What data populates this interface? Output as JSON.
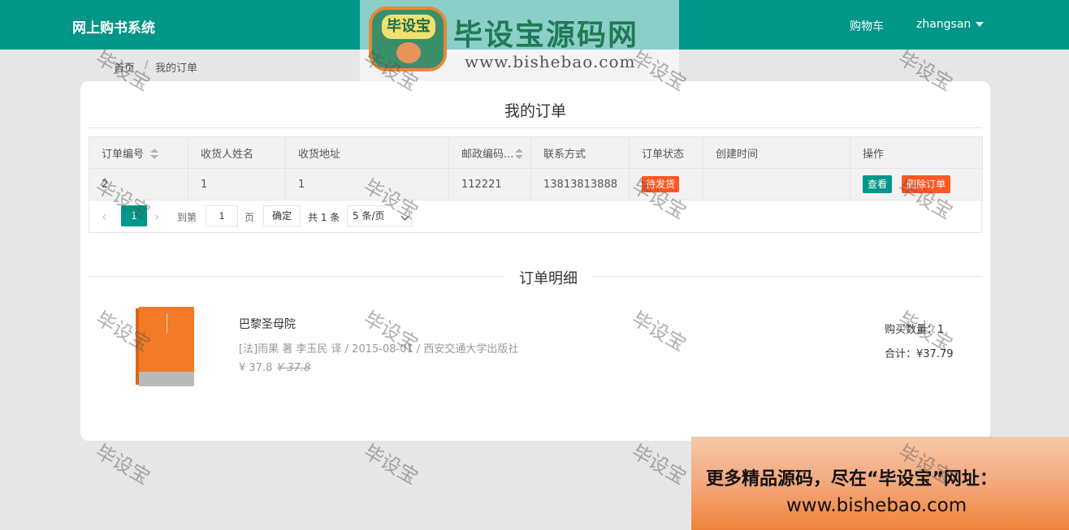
{
  "header": {
    "app_title": "网上购书系统",
    "cart_label": "购物车",
    "username": "zhangsan"
  },
  "watermark": {
    "badge": "毕设宝",
    "title": "毕设宝源码网",
    "url": "www.bishebao.com",
    "stamp": "毕设宝"
  },
  "breadcrumb": {
    "home": "首页",
    "separator": "/",
    "current": "我的订单"
  },
  "page_title": "我的订单",
  "orders_table": {
    "columns": [
      "订单编号",
      "收货人姓名",
      "收货地址",
      "邮政编码...",
      "联系方式",
      "订单状态",
      "创建时间",
      "操作"
    ],
    "rows": [
      {
        "order_no": "2",
        "receiver": "1",
        "address": "1",
        "zip": "112221",
        "phone": "13813813888",
        "status": "待发货",
        "created": "",
        "view_label": "查看",
        "delete_label": "删除订单"
      }
    ]
  },
  "pager": {
    "prev": "‹",
    "current_page": "1",
    "next": "›",
    "goto_label": "到第",
    "goto_value": "1",
    "page_unit": "页",
    "confirm_label": "确定",
    "total": "共 1 条",
    "page_size": "5 条/页"
  },
  "detail": {
    "title": "订单明细",
    "book_name": "巴黎圣母院",
    "book_info": "[法]雨果 著 李玉民 译 / 2015-08-01 / 西安交通大学出版社",
    "price": "¥ 37.8",
    "old_price": "¥ 37.8",
    "quantity": "购买数量：1",
    "subtotal": "合计：¥37.79"
  },
  "promo": {
    "line1": "更多精品源码，尽在“毕设宝”网址：",
    "line2": "www.bishebao.com"
  },
  "colors": {
    "primary": "#009688",
    "danger": "#ff5722",
    "background": "#e6e6e6"
  }
}
